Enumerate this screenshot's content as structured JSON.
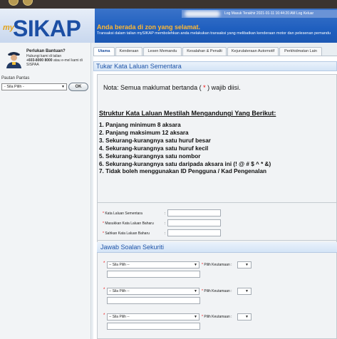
{
  "header": {
    "logo_prefix": "my",
    "logo_name": "SIKAP",
    "welcome": "Anda berada di zon yang selamat.",
    "description": "Transaksi dalam talian mySIKAP membolehkan anda melakukan transaksi yang melibatkan kenderaan motor dan pelesenan pemandu",
    "login_info": "Log Masuk Terakhir 2021-01-11 16:44:20 AM   Log Keluar"
  },
  "sidebar": {
    "help_title": "Perlukan Bantuan?",
    "help_line1": "Hubungi kami di talian",
    "help_phone": "+603-8000 8000",
    "help_line2": "atau e-mel kami di SISPAA",
    "links_label": "Pautan Pantas",
    "links_select": "- Sila Pilih -",
    "ok_label": "OK"
  },
  "tabs": [
    "Utama",
    "Kenderaan",
    "Lesen Memandu",
    "Kesalahan & Penalti",
    "Kejurulateraan Automotif",
    "Perkhidmatan Lain"
  ],
  "panel": {
    "title": "Tukar Kata Laluan Sementara",
    "note_prefix": "Nota: Semua maklumat bertanda (",
    "note_star": " * ",
    "note_suffix": ") wajib diisi.",
    "rules_title": "Struktur Kata Laluan Mestilah Mengandungi Yang Berikut:",
    "rules": [
      "1. Panjang minimum 8 aksara",
      "2. Panjang maksimum 12 aksara",
      "3. Sekurang-kurangnya satu huruf besar",
      "4. Sekurang-kurangnya satu huruf kecil",
      "5. Sekurang-kurangnya satu nombor",
      "6. Sekurang-kurangnya satu daripada aksara ini (! @ # $ ^ * &)",
      "7. Tidak boleh menggunakan ID Pengguna / Kad Pengenalan"
    ]
  },
  "form": {
    "temp_password": "Kata Laluan Sementara",
    "new_password": "Masukkan Kata Laluan Baharu",
    "confirm_password": "Sahkan Kata Laluan Baharu"
  },
  "security": {
    "title": "Jawab Soalan Sekuriti",
    "select_placeholder": "-- Sila Pilih --",
    "priority_label": "Pilih Keutamaan :"
  }
}
